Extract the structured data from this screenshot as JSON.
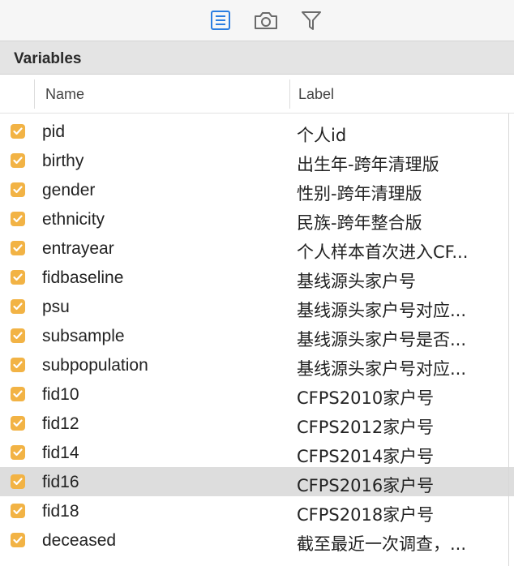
{
  "toolbar": {
    "icons": [
      "list-view-icon",
      "camera-icon",
      "filter-icon"
    ],
    "accent": "#2a7de1"
  },
  "section": {
    "title": "Variables"
  },
  "table": {
    "columns": {
      "name": "Name",
      "label": "Label"
    },
    "check_color": "#f2b345",
    "rows": [
      {
        "name": "pid",
        "label": "个人id",
        "checked": true
      },
      {
        "name": "birthy",
        "label": "出生年-跨年清理版",
        "checked": true
      },
      {
        "name": "gender",
        "label": "性别-跨年清理版",
        "checked": true
      },
      {
        "name": "ethnicity",
        "label": "民族-跨年整合版",
        "checked": true
      },
      {
        "name": "entrayear",
        "label": "个人样本首次进入CF...",
        "checked": true
      },
      {
        "name": "fidbaseline",
        "label": "基线源头家户号",
        "checked": true
      },
      {
        "name": "psu",
        "label": "基线源头家户号对应...",
        "checked": true
      },
      {
        "name": "subsample",
        "label": "基线源头家户号是否...",
        "checked": true
      },
      {
        "name": "subpopulation",
        "label": "基线源头家户号对应...",
        "checked": true
      },
      {
        "name": "fid10",
        "label": "CFPS2010家户号",
        "checked": true
      },
      {
        "name": "fid12",
        "label": "CFPS2012家户号",
        "checked": true
      },
      {
        "name": "fid14",
        "label": "CFPS2014家户号",
        "checked": true
      },
      {
        "name": "fid16",
        "label": "CFPS2016家户号",
        "checked": true,
        "selected": true
      },
      {
        "name": "fid18",
        "label": "CFPS2018家户号",
        "checked": true
      },
      {
        "name": "deceased",
        "label": "截至最近一次调查，...",
        "checked": true
      }
    ]
  }
}
